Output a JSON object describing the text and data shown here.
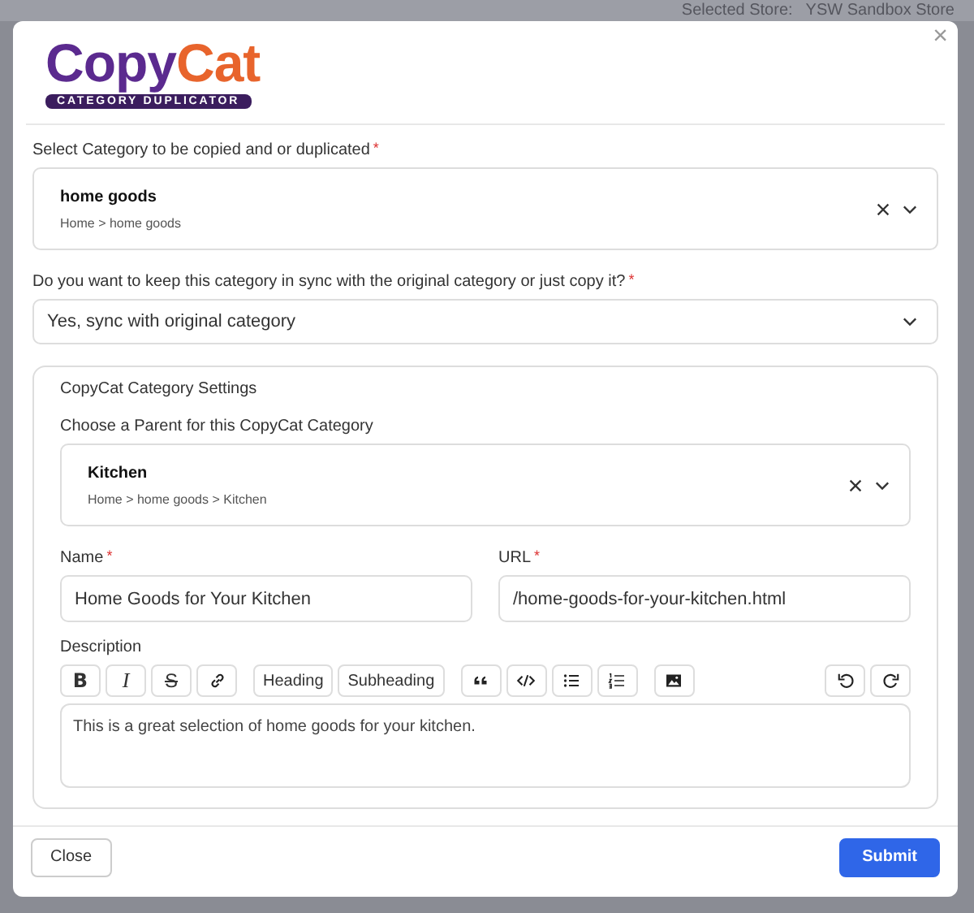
{
  "background": {
    "store_label": "Selected Store:",
    "store_name": "YSW Sandbox Store"
  },
  "logo": {
    "word_1": "Copy",
    "word_2": "Cat",
    "tagline": "CATEGORY DUPLICATOR"
  },
  "close_icon_label": "×",
  "source_category": {
    "label": "Select Category to be copied and or duplicated",
    "required_mark": "*",
    "value": "home goods",
    "path": "Home > home goods"
  },
  "sync_mode": {
    "label": "Do you want to keep this category in sync with the original category or just copy it?",
    "required_mark": "*",
    "value": "Yes, sync with original category"
  },
  "settings": {
    "title": "CopyCat Category Settings",
    "parent": {
      "label": "Choose a Parent for this CopyCat Category",
      "value": "Kitchen",
      "path": "Home > home goods > Kitchen"
    },
    "name": {
      "label": "Name",
      "required_mark": "*",
      "value": "Home Goods for Your Kitchen"
    },
    "url": {
      "label": "URL",
      "required_mark": "*",
      "value": "/home-goods-for-your-kitchen.html"
    },
    "description": {
      "label": "Description",
      "value": "This is a great selection of home goods for your kitchen.",
      "toolbar": [
        {
          "kind": "bold",
          "text": "B"
        },
        {
          "kind": "italic",
          "text": "I"
        },
        {
          "kind": "strike",
          "text": "S"
        },
        {
          "kind": "link"
        },
        {
          "kind": "text",
          "text": "Heading"
        },
        {
          "kind": "text",
          "text": "Subheading"
        },
        {
          "kind": "quote"
        },
        {
          "kind": "code"
        },
        {
          "kind": "bullets"
        },
        {
          "kind": "numbers"
        },
        {
          "kind": "image"
        },
        {
          "kind": "undo"
        },
        {
          "kind": "redo"
        }
      ]
    }
  },
  "buttons": [
    {
      "kind": "secondary",
      "label": "Close"
    },
    {
      "kind": "primary",
      "label": "Submit"
    }
  ]
}
